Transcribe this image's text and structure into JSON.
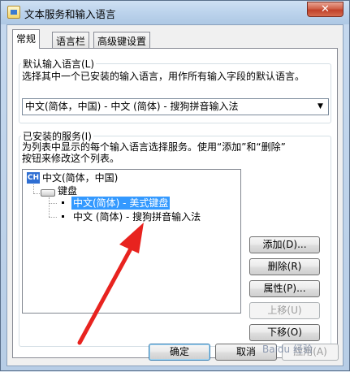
{
  "window": {
    "title": "文本服务和输入语言",
    "close_glyph": "✕"
  },
  "tabs": [
    {
      "label": "常规",
      "active": true
    },
    {
      "label": "语言栏",
      "active": false
    },
    {
      "label": "高级键设置",
      "active": false
    }
  ],
  "default_language": {
    "title": "默认输入语言(L)",
    "description": "选择其中一个已安装的输入语言，用作所有输入字段的默认语言。",
    "selected_value": "中文(简体，中国) - 中文 (简体) - 搜狗拼音输入法",
    "dropdown_icon": "▼"
  },
  "installed_services": {
    "title": "已安装的服务(I)",
    "description_line1": "为列表中显示的每个输入语言选择服务。使用“添加”和“删除”",
    "description_line2": "按钮来修改这个列表。",
    "tree": {
      "language_code": "CH",
      "language": "中文(简体，中国)",
      "keyboard_group": "键盘",
      "services": [
        {
          "label": "中文(简体) - 美式键盘",
          "selected": true
        },
        {
          "label": "中文 (简体) - 搜狗拼音输入法",
          "selected": false
        }
      ]
    },
    "buttons": {
      "add": "添加(D)...",
      "remove": "删除(R)",
      "properties": "属性(P)...",
      "move_up": "上移(U)",
      "move_down": "下移(O)"
    }
  },
  "footer": {
    "ok": "确定",
    "cancel": "取消",
    "apply": "应用(A)"
  },
  "watermark": "Baidu 经验",
  "colors": {
    "selection": "#3399ff",
    "annotation_arrow": "#e8231f"
  }
}
